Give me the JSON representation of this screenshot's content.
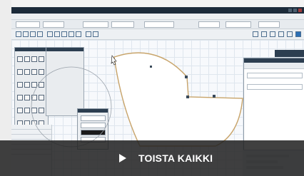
{
  "playlist_thumbnail": {
    "action_label": "TOISTA KAIKKI",
    "action_icon": "play-icon",
    "overlay_color": "#212121",
    "text_color": "#ffffff"
  },
  "screenshot": {
    "app_ui_colors": {
      "title_bar": "#1c2b3a",
      "panel_header": "#2c3e50",
      "shape_outline": "#c8a46a",
      "grid": "#dfe6ee"
    }
  }
}
